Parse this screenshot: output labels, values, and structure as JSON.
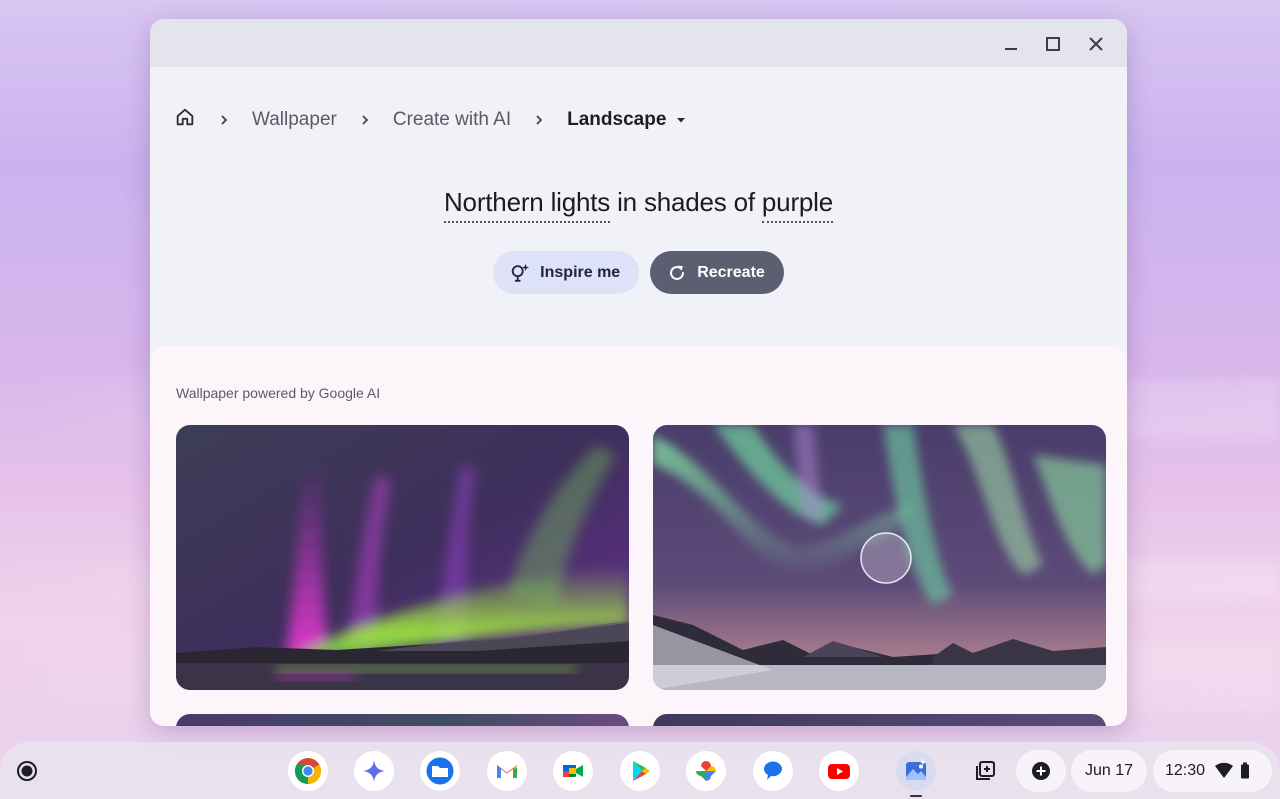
{
  "window": {
    "controls": {
      "minimize_icon": "minimize-icon",
      "maximize_icon": "maximize-icon",
      "close_icon": "close-icon"
    }
  },
  "breadcrumb": {
    "home_icon": "home-icon",
    "items": [
      {
        "label": "Wallpaper"
      },
      {
        "label": "Create with AI"
      }
    ],
    "current": "Landscape"
  },
  "prompt": {
    "part1": "Northern lights",
    "part2": " in shades of ",
    "part3": "purple"
  },
  "actions": {
    "inspire_label": "Inspire me",
    "recreate_label": "Recreate"
  },
  "results": {
    "label": "Wallpaper powered by Google AI"
  },
  "shelf": {
    "launcher_icon": "launcher-icon",
    "apps": [
      {
        "name": "Chrome",
        "icon": "chrome-icon"
      },
      {
        "name": "Gemini",
        "icon": "gemini-icon"
      },
      {
        "name": "Files",
        "icon": "files-icon"
      },
      {
        "name": "Gmail",
        "icon": "gmail-icon"
      },
      {
        "name": "Meet",
        "icon": "meet-icon"
      },
      {
        "name": "Play Store",
        "icon": "play-store-icon"
      },
      {
        "name": "Photos",
        "icon": "photos-icon"
      },
      {
        "name": "Messages",
        "icon": "messages-icon"
      },
      {
        "name": "YouTube",
        "icon": "youtube-icon"
      },
      {
        "name": "Wallpaper",
        "icon": "wallpaper-app-icon"
      }
    ],
    "date": "Jun 17",
    "time": "12:30",
    "tray_icons": [
      "holding-space-icon",
      "add-icon",
      "wifi-icon",
      "battery-icon"
    ]
  },
  "colors": {
    "recreate_bg": "#5c5f72",
    "inspire_bg": "#dde2f8",
    "panel_bg": "#fcf6fb"
  }
}
